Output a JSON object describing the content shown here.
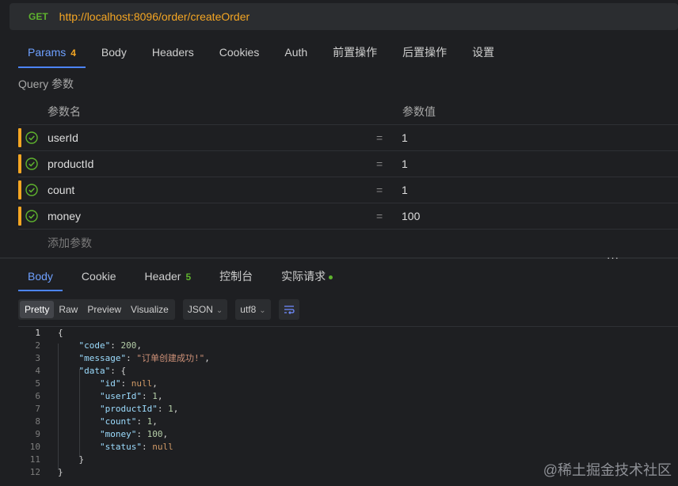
{
  "request": {
    "method": "GET",
    "url": "http://localhost:8096/order/createOrder"
  },
  "request_tabs": [
    {
      "label": "Params",
      "count": "4",
      "active": true
    },
    {
      "label": "Body"
    },
    {
      "label": "Headers"
    },
    {
      "label": "Cookies"
    },
    {
      "label": "Auth"
    },
    {
      "label": "前置操作"
    },
    {
      "label": "后置操作"
    },
    {
      "label": "设置"
    }
  ],
  "query_section_title": "Query 参数",
  "params_table": {
    "col_name": "参数名",
    "col_value": "参数值",
    "rows": [
      {
        "name": "userId",
        "eq": "=",
        "value": "1"
      },
      {
        "name": "productId",
        "eq": "=",
        "value": "1"
      },
      {
        "name": "count",
        "eq": "=",
        "value": "1"
      },
      {
        "name": "money",
        "eq": "=",
        "value": "100"
      }
    ],
    "add_placeholder": "添加参数"
  },
  "splitter_handle": "···",
  "response_tabs": [
    {
      "label": "Body",
      "active": true
    },
    {
      "label": "Cookie"
    },
    {
      "label": "Header",
      "count": "5"
    },
    {
      "label": "控制台"
    },
    {
      "label": "实际请求",
      "dot": true
    }
  ],
  "view_modes": [
    "Pretty",
    "Raw",
    "Preview",
    "Visualize"
  ],
  "format_select": "JSON",
  "encoding_select": "utf8",
  "code_lines": [
    {
      "n": "1",
      "text": "{"
    },
    {
      "n": "2",
      "text": "    \"code\": 200,"
    },
    {
      "n": "3",
      "text": "    \"message\": \"订单创建成功!\","
    },
    {
      "n": "4",
      "text": "    \"data\": {"
    },
    {
      "n": "5",
      "text": "        \"id\": null,"
    },
    {
      "n": "6",
      "text": "        \"userId\": 1,"
    },
    {
      "n": "7",
      "text": "        \"productId\": 1,"
    },
    {
      "n": "8",
      "text": "        \"count\": 1,"
    },
    {
      "n": "9",
      "text": "        \"money\": 100,"
    },
    {
      "n": "10",
      "text": "        \"status\": null"
    },
    {
      "n": "11",
      "text": "    }"
    },
    {
      "n": "12",
      "text": "}"
    }
  ],
  "watermark": "@稀土掘金技术社区",
  "colors": {
    "accent": "#4c84ff",
    "method_get": "#5fb32e",
    "url": "#f5a623",
    "param_bar": "#f5a623",
    "check": "#5fb32e"
  },
  "icons": {
    "param_enabled": "check-circle-icon",
    "format_select": "chevron-down-icon",
    "wrap": "wrap-lines-icon"
  }
}
